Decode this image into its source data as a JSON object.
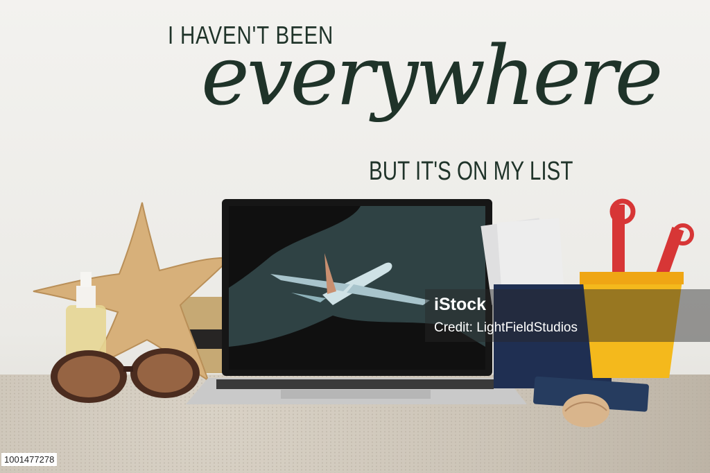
{
  "headline": {
    "top": "I HAVEN'T BEEN",
    "script": "everywhere",
    "bottom": "BUT IT'S ON MY LIST"
  },
  "watermark": {
    "brand": "iStock",
    "credit": "Credit: LightFieldStudios"
  },
  "stock_id": "1001477278",
  "colors": {
    "headline_text": "#1f3329",
    "screen_bg": "#2f4244",
    "bucket_yellow": "#f4b91c",
    "shovel_red": "#d73636",
    "passport_navy": "#1f2f52"
  }
}
